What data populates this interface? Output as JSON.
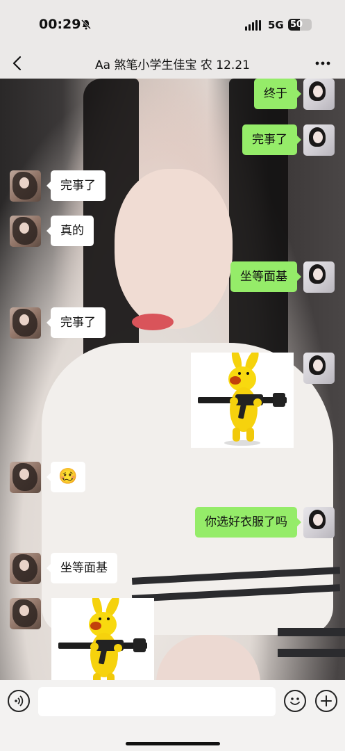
{
  "status_bar": {
    "time": "00:29",
    "network": "5G",
    "battery": "50",
    "battery_level_percent": 50,
    "icons": [
      "bell-muted-icon",
      "signal-icon",
      "battery-icon"
    ]
  },
  "nav": {
    "title": "Aa 煞笔小学生佳宝 农 12.21",
    "icons": [
      "back-chevron-icon",
      "more-dots-icon"
    ]
  },
  "messages": [
    {
      "side": "out",
      "type": "text",
      "text": "终于"
    },
    {
      "side": "out",
      "type": "text",
      "text": "完事了"
    },
    {
      "side": "in",
      "type": "text",
      "text": "完事了"
    },
    {
      "side": "in",
      "type": "text",
      "text": "真的"
    },
    {
      "side": "out",
      "type": "text",
      "text": "坐等面基"
    },
    {
      "side": "in",
      "type": "text",
      "text": "完事了"
    },
    {
      "side": "out",
      "type": "sticker",
      "sticker": "yellow-dog-with-rifle"
    },
    {
      "side": "in",
      "type": "emoji",
      "emoji": "🥴"
    },
    {
      "side": "out",
      "type": "text",
      "text": "你选好衣服了吗"
    },
    {
      "side": "in",
      "type": "text",
      "text": "坐等面基"
    },
    {
      "side": "in",
      "type": "sticker",
      "sticker": "yellow-dog-with-rifle"
    }
  ],
  "input_bar": {
    "placeholder": "",
    "value": "",
    "icons": [
      "voice-icon",
      "emoji-icon",
      "plus-icon"
    ]
  },
  "colors": {
    "outgoing_bubble": "#95ec69",
    "incoming_bubble": "#ffffff",
    "bar_background": "#ebe9e8"
  }
}
